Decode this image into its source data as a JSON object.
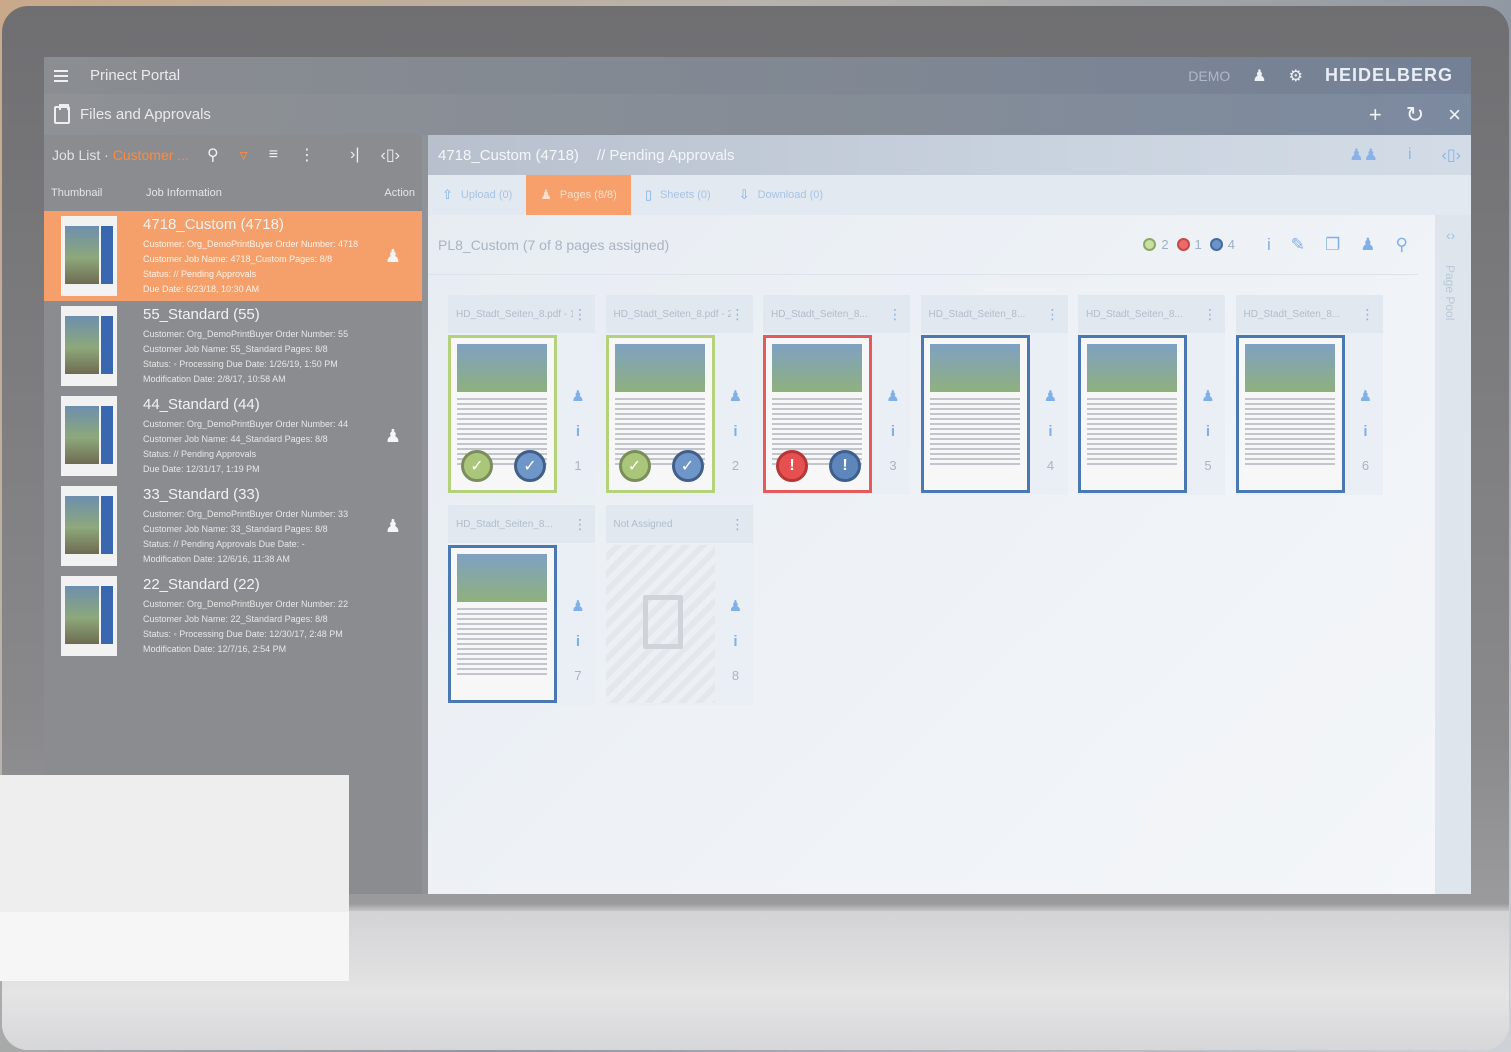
{
  "app": {
    "title": "Prinect Portal",
    "demo_label": "DEMO",
    "brand": "HEIDELBERG"
  },
  "section": {
    "title": "Files and Approvals"
  },
  "icons": {
    "hamburger": "menu-icon",
    "user": "user-icon",
    "settings": "gear-icon",
    "add": "plus-icon",
    "refresh": "refresh-icon",
    "close": "close-icon"
  },
  "job_list": {
    "label": "Job List",
    "filter_label": "Customer ...",
    "columns": {
      "thumbnail": "Thumbnail",
      "info": "Job Information",
      "action": "Action"
    },
    "jobs": [
      {
        "title": "4718_Custom (4718)",
        "lines": [
          "Customer: Org_DemoPrintBuyer  Order Number: 4718",
          "Customer Job Name: 4718_Custom  Pages: 8/8",
          "Status: // Pending Approvals",
          "Due Date: 6/23/18, 10:30 AM"
        ],
        "has_action": true
      },
      {
        "title": "55_Standard (55)",
        "lines": [
          "Customer: Org_DemoPrintBuyer  Order Number: 55",
          "Customer Job Name: 55_Standard  Pages: 8/8",
          "Status: ◦ Processing  Due Date: 1/26/19, 1:50 PM",
          "Modification Date: 2/8/17, 10:58 AM"
        ],
        "has_action": false
      },
      {
        "title": "44_Standard (44)",
        "lines": [
          "Customer: Org_DemoPrintBuyer  Order Number: 44",
          "Customer Job Name: 44_Standard  Pages: 8/8",
          "Status: // Pending Approvals",
          "Due Date: 12/31/17, 1:19 PM"
        ],
        "has_action": true
      },
      {
        "title": "33_Standard (33)",
        "lines": [
          "Customer: Org_DemoPrintBuyer  Order Number: 33",
          "Customer Job Name: 33_Standard  Pages: 8/8",
          "Status: // Pending Approvals  Due Date: -",
          "Modification Date: 12/6/16, 11:38 AM"
        ],
        "has_action": true
      },
      {
        "title": "22_Standard (22)",
        "lines": [
          "Customer: Org_DemoPrintBuyer  Order Number: 22",
          "Customer Job Name: 22_Standard  Pages: 8/8",
          "Status: ◦ Processing  Due Date: 12/30/17, 2:48 PM",
          "Modification Date: 12/7/16, 2:54 PM"
        ],
        "has_action": false
      }
    ]
  },
  "detail": {
    "job_name": "4718_Custom (4718)",
    "status": "// Pending Approvals",
    "tabs": [
      {
        "label": "Upload (0)",
        "icon": "upload-icon"
      },
      {
        "label": "Pages (8/8)",
        "icon": "pages-icon"
      },
      {
        "label": "Sheets (0)",
        "icon": "sheets-icon"
      },
      {
        "label": "Download (0)",
        "icon": "download-icon"
      }
    ],
    "pagelist_title": "PL8_Custom (7 of 8 pages assigned)",
    "legend": {
      "green": "2",
      "red": "1",
      "blue": "4"
    },
    "page_pool_label": "Page Pool",
    "pages": [
      {
        "name": "HD_Stadt_Seiten_8.pdf - 1",
        "num": "1",
        "state": "green"
      },
      {
        "name": "HD_Stadt_Seiten_8.pdf - 2",
        "num": "2",
        "state": "green"
      },
      {
        "name": "HD_Stadt_Seiten_8...",
        "num": "3",
        "state": "red"
      },
      {
        "name": "HD_Stadt_Seiten_8...",
        "num": "4",
        "state": "blue"
      },
      {
        "name": "HD_Stadt_Seiten_8...",
        "num": "5",
        "state": "blue"
      },
      {
        "name": "HD_Stadt_Seiten_8...",
        "num": "6",
        "state": "blue"
      },
      {
        "name": "HD_Stadt_Seiten_8...",
        "num": "7",
        "state": "blue"
      },
      {
        "name": "Not Assigned",
        "num": "8",
        "state": "empty"
      }
    ]
  },
  "colors": {
    "accent": "#ff8a3d",
    "approved": "#a9c67a",
    "rejected": "#e65050",
    "pending": "#6f96c9"
  }
}
